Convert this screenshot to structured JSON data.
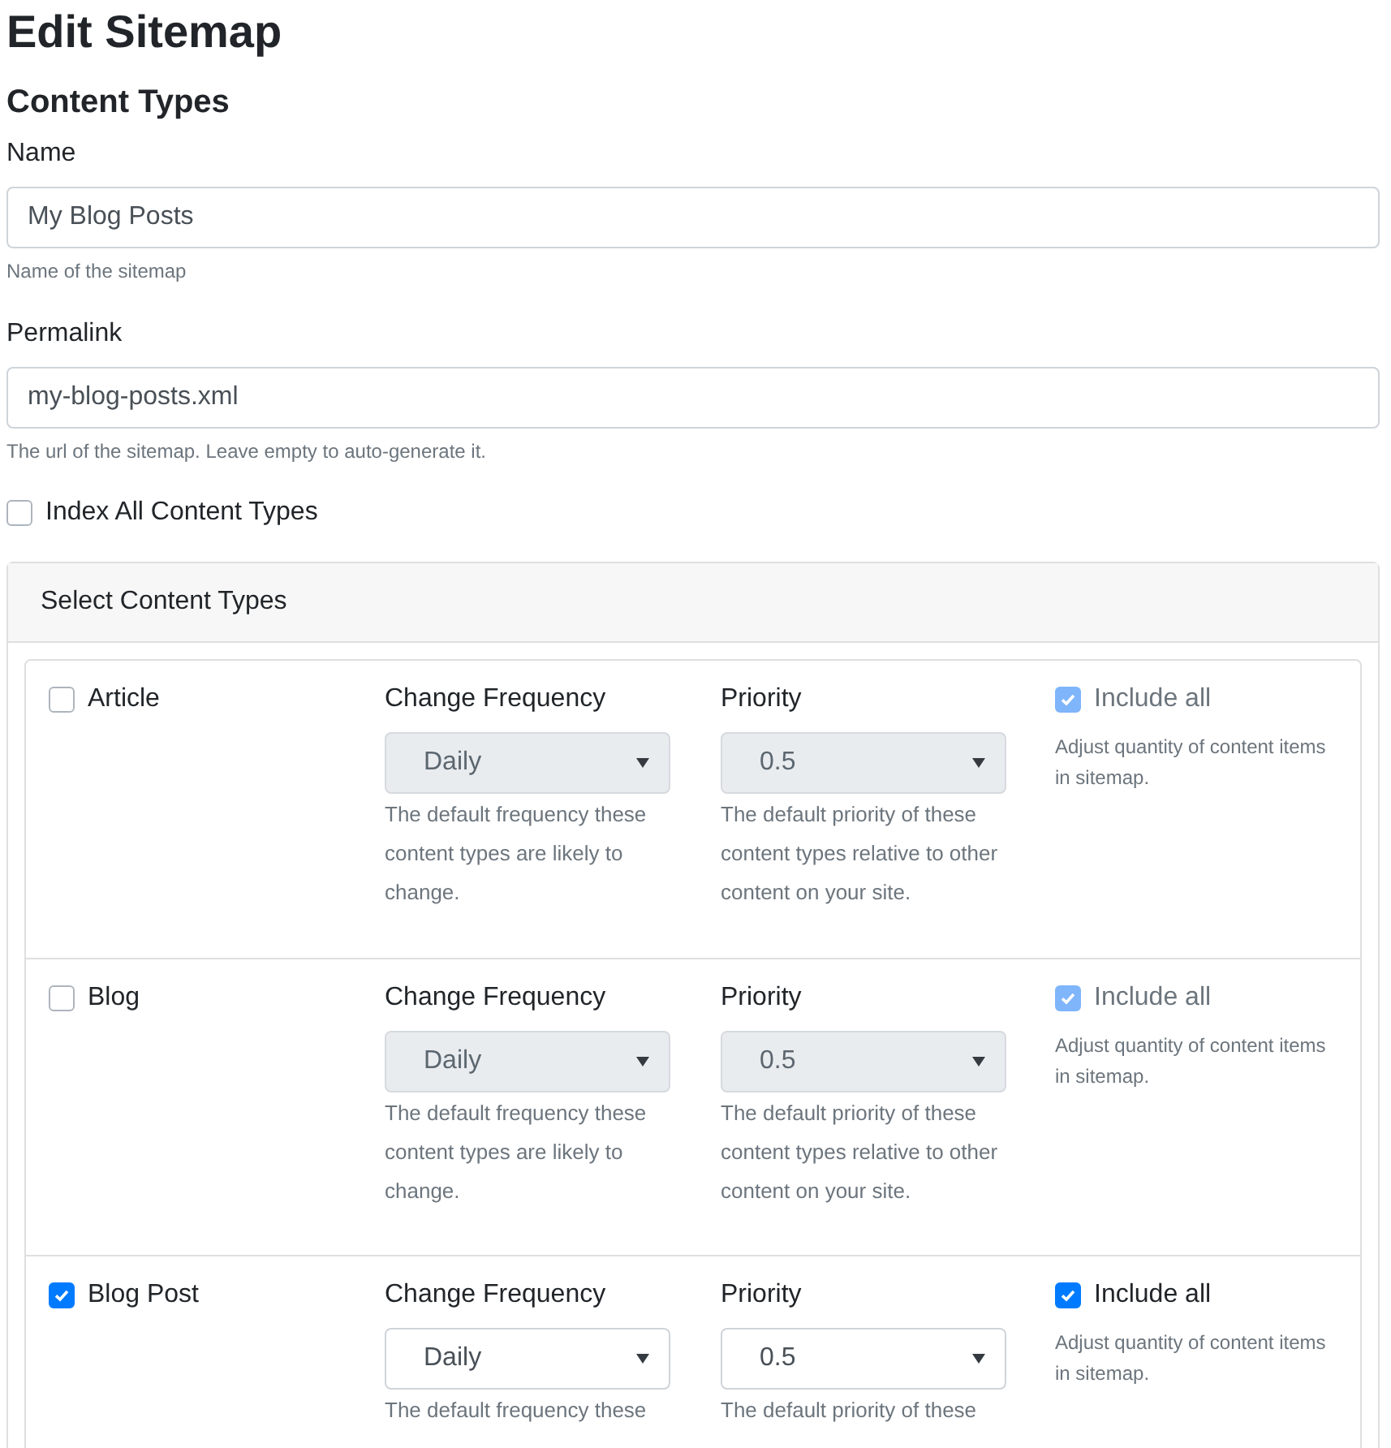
{
  "title": "Edit Sitemap",
  "section_title": "Content Types",
  "name_field": {
    "label": "Name",
    "value": "My Blog Posts",
    "help": "Name of the sitemap"
  },
  "permalink_field": {
    "label": "Permalink",
    "value": "my-blog-posts.xml",
    "help": "The url of the sitemap. Leave empty to auto-generate it."
  },
  "index_all": {
    "label": "Index All Content Types",
    "checked": false
  },
  "panel": {
    "title": "Select Content Types"
  },
  "content_types": [
    {
      "name": "Article",
      "checked": false,
      "frequency_label": "Change Frequency",
      "frequency": "Daily",
      "frequency_help": "The default frequency these content types are likely to change.",
      "priority_label": "Priority",
      "priority": "0.5",
      "priority_help": "The default priority of these content types relative to other content on your site.",
      "include_all": {
        "label": "Include all",
        "checked": true,
        "disabled": true
      },
      "include_help": "Adjust quantity of content items in sitemap.",
      "disabled": true
    },
    {
      "name": "Blog",
      "checked": false,
      "frequency_label": "Change Frequency",
      "frequency": "Daily",
      "frequency_help": "The default frequency these content types are likely to change.",
      "priority_label": "Priority",
      "priority": "0.5",
      "priority_help": "The default priority of these content types relative to other content on your site.",
      "include_all": {
        "label": "Include all",
        "checked": true,
        "disabled": true
      },
      "include_help": "Adjust quantity of content items in sitemap.",
      "disabled": true
    },
    {
      "name": "Blog Post",
      "checked": true,
      "frequency_label": "Change Frequency",
      "frequency": "Daily",
      "frequency_help": "The default frequency these",
      "priority_label": "Priority",
      "priority": "0.5",
      "priority_help": "The default priority of these",
      "include_all": {
        "label": "Include all",
        "checked": true,
        "disabled": false
      },
      "include_help": "Adjust quantity of content items in sitemap.",
      "disabled": false
    }
  ]
}
